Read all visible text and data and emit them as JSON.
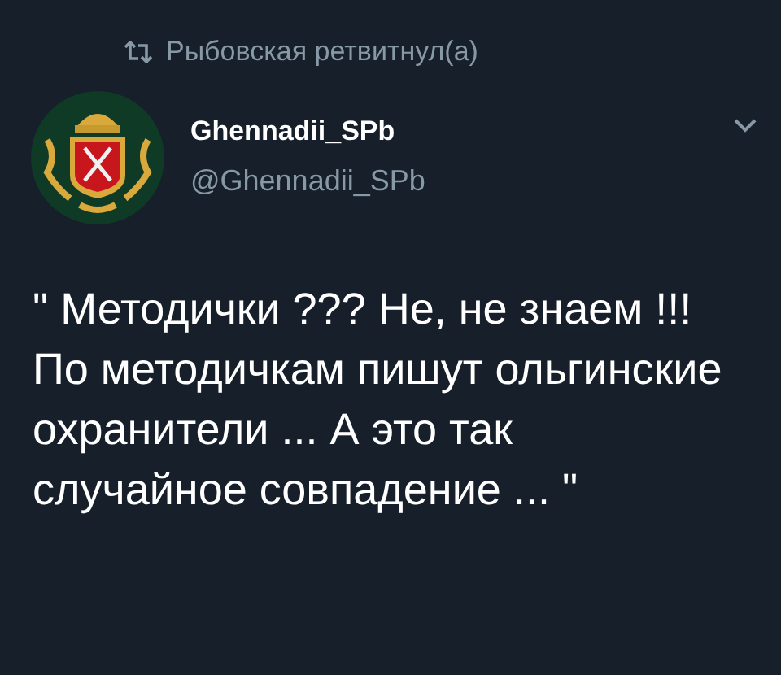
{
  "retweet_banner": {
    "text": "Рыбовская ретвитнул(а)"
  },
  "tweet": {
    "display_name": "Ghennadii_SPb",
    "handle": "@Ghennadii_SPb",
    "text": "\" Методички ??? Не, не знаем !!!\nПо методичкам пишут ольгинские охранители ... А это так случайное совпадение ... \""
  }
}
